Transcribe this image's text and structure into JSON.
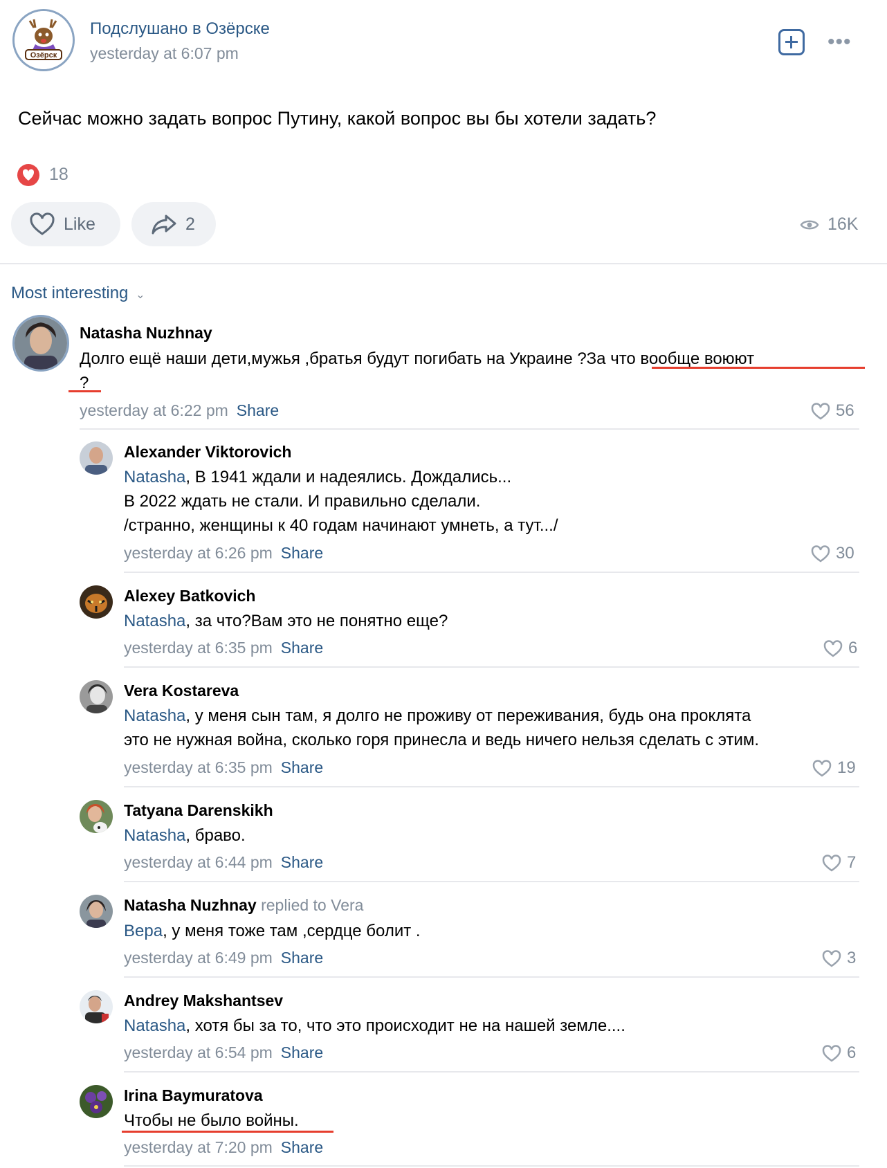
{
  "post": {
    "group_name": "Подслушано в Озёрске",
    "logo_text": "Озёрск",
    "time": "yesterday at 6:07 pm",
    "text": "Сейчас можно задать вопрос Путину, какой вопрос вы бы хотели задать?",
    "reactions_count": "18",
    "like_label": "Like",
    "share_count": "2",
    "views": "16K"
  },
  "sort_label": "Most interesting",
  "share_label": "Share",
  "main_comment": {
    "author": "Natasha Nuzhnay",
    "text_line1": "Долго ещё наши дети,мужья ,братья будут погибать на Украине ?За что вообще воюют",
    "text_line2": "?",
    "time": "yesterday at 6:22 pm",
    "likes": "56"
  },
  "replies": [
    {
      "author": "Alexander Viktorovich",
      "mention": "Natasha",
      "text": ", В 1941 ждали и надеялись. Дождались...",
      "text2": "В 2022 ждать не стали. И правильно сделали.",
      "text3": "/странно, женщины к 40 годам начинают умнеть, а тут.../",
      "time": "yesterday at 6:26 pm",
      "likes": "30"
    },
    {
      "author": "Alexey Batkovich",
      "mention": "Natasha",
      "text": ", за что?Вам это не понятно еще?",
      "time": "yesterday at 6:35 pm",
      "likes": "6"
    },
    {
      "author": "Vera Kostareva",
      "mention": "Natasha",
      "text": ", у меня сын там, я долго не проживу от переживания, будь она проклята",
      "text2": "это не нужная война, сколько горя принесла и ведь ничего нельзя сделать с этим.",
      "time": "yesterday at 6:35 pm",
      "likes": "19"
    },
    {
      "author": "Tatyana Darenskikh",
      "mention": "Natasha",
      "text": ", браво.",
      "time": "yesterday at 6:44 pm",
      "likes": "7"
    },
    {
      "author": "Natasha Nuzhnay",
      "replied_to": "replied to Vera",
      "mention": "Вера",
      "text": ", у меня тоже там ,сердце болит .",
      "time": "yesterday at 6:49 pm",
      "likes": "3"
    },
    {
      "author": "Andrey Makshantsev",
      "mention": "Natasha",
      "text": ", хотя бы за то, что это происходит не на нашей земле....",
      "time": "yesterday at 6:54 pm",
      "likes": "6"
    },
    {
      "author": "Irina Baymuratova",
      "text": "Чтобы не было войны.",
      "time": "yesterday at 7:20 pm"
    }
  ]
}
